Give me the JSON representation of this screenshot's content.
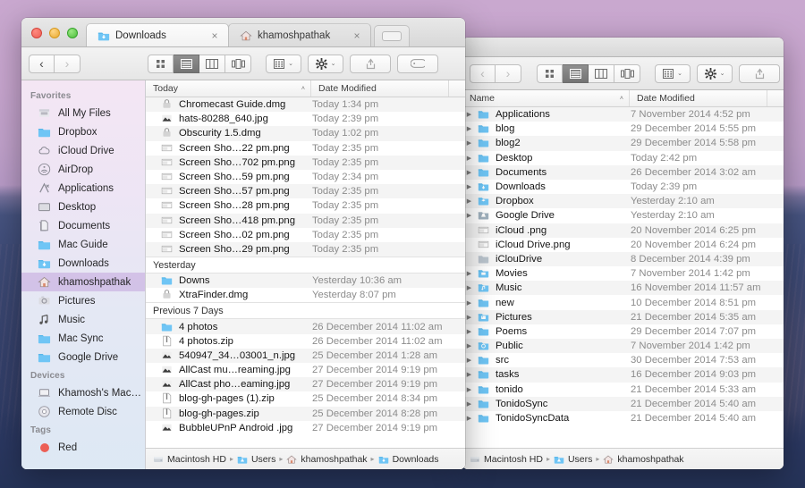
{
  "window_left": {
    "tabs": [
      {
        "label": "Downloads",
        "icon": "downloads-folder-icon",
        "active": true,
        "close": "×"
      },
      {
        "label": "khamoshpathak",
        "icon": "home-folder-icon",
        "active": false,
        "close": "×"
      }
    ],
    "new_tab_label": "+",
    "toolbar": {
      "back": "‹",
      "forward": "›",
      "view_icon": "icon-view-icon",
      "view_list": "list-view-icon",
      "view_column": "column-view-icon",
      "view_coverflow": "coverflow-view-icon",
      "arrange": "arrange-icon",
      "action": "gear-icon",
      "share": "share-icon",
      "tags": "tag-icon",
      "dropbox": "dropbox-icon",
      "overflow": "»",
      "caret": "⌄"
    },
    "columns": {
      "name": "Today",
      "date": "Date Modified",
      "sort": "˄"
    },
    "groups": [
      {
        "title": "Today",
        "is_header_column": true,
        "files": [
          {
            "name": "Chromecast Guide.dmg",
            "date": "Today 1:34 pm",
            "icon": "dmg-icon"
          },
          {
            "name": "hats-80288_640.jpg",
            "date": "Today 2:39 pm",
            "icon": "jpg-icon"
          },
          {
            "name": "Obscurity 1.5.dmg",
            "date": "Today 1:02 pm",
            "icon": "dmg-icon"
          },
          {
            "name": "Screen Sho…22 pm.png",
            "date": "Today 2:35 pm",
            "icon": "png-thumb-icon"
          },
          {
            "name": "Screen Sho…702 pm.png",
            "date": "Today 2:35 pm",
            "icon": "png-thumb-icon"
          },
          {
            "name": "Screen Sho…59 pm.png",
            "date": "Today 2:34 pm",
            "icon": "png-thumb-icon"
          },
          {
            "name": "Screen Sho…57 pm.png",
            "date": "Today 2:35 pm",
            "icon": "png-thumb-icon"
          },
          {
            "name": "Screen Sho…28 pm.png",
            "date": "Today 2:35 pm",
            "icon": "png-thumb-icon"
          },
          {
            "name": "Screen Sho…418 pm.png",
            "date": "Today 2:35 pm",
            "icon": "png-thumb-icon"
          },
          {
            "name": "Screen Sho…02 pm.png",
            "date": "Today 2:35 pm",
            "icon": "png-thumb-icon"
          },
          {
            "name": "Screen Sho…29 pm.png",
            "date": "Today 2:35 pm",
            "icon": "png-thumb-icon"
          }
        ]
      },
      {
        "title": "Yesterday",
        "files": [
          {
            "name": "Downs",
            "date": "Yesterday 10:36 am",
            "icon": "folder-icon"
          },
          {
            "name": "XtraFinder.dmg",
            "date": "Yesterday 8:07 pm",
            "icon": "dmg-icon"
          }
        ]
      },
      {
        "title": "Previous 7 Days",
        "files": [
          {
            "name": "4 photos",
            "date": "26 December 2014 11:02 am",
            "icon": "folder-icon"
          },
          {
            "name": "4 photos.zip",
            "date": "26 December 2014 11:02 am",
            "icon": "zip-icon"
          },
          {
            "name": "540947_34…03001_n.jpg",
            "date": "25 December 2014 1:28 am",
            "icon": "jpg-icon"
          },
          {
            "name": "AllCast mu…reaming.jpg",
            "date": "27 December 2014 9:19 pm",
            "icon": "jpg-icon"
          },
          {
            "name": "AllCast pho…eaming.jpg",
            "date": "27 December 2014 9:19 pm",
            "icon": "jpg-icon"
          },
          {
            "name": "blog-gh-pages (1).zip",
            "date": "25 December 2014 8:34 pm",
            "icon": "zip-icon"
          },
          {
            "name": "blog-gh-pages.zip",
            "date": "25 December 2014 8:28 pm",
            "icon": "zip-icon"
          },
          {
            "name": "BubbleUPnP Android .jpg",
            "date": "27 December 2014 9:19 pm",
            "icon": "jpg-icon"
          }
        ]
      }
    ],
    "pathbar": [
      {
        "label": "Macintosh HD",
        "icon": "harddisk-icon"
      },
      {
        "label": "Users",
        "icon": "users-folder-icon"
      },
      {
        "label": "khamoshpathak",
        "icon": "home-folder-icon"
      },
      {
        "label": "Downloads",
        "icon": "downloads-folder-icon"
      }
    ],
    "path_separator": "▸"
  },
  "sidebar": {
    "sections": [
      {
        "title": "Favorites",
        "items": [
          {
            "label": "All My Files",
            "icon": "all-my-files-icon",
            "selected": false
          },
          {
            "label": "Dropbox",
            "icon": "folder-icon",
            "selected": false
          },
          {
            "label": "iCloud Drive",
            "icon": "icloud-icon",
            "selected": false
          },
          {
            "label": "AirDrop",
            "icon": "airdrop-icon",
            "selected": false
          },
          {
            "label": "Applications",
            "icon": "applications-icon",
            "selected": false
          },
          {
            "label": "Desktop",
            "icon": "desktop-icon",
            "selected": false
          },
          {
            "label": "Documents",
            "icon": "documents-icon",
            "selected": false
          },
          {
            "label": "Mac Guide",
            "icon": "folder-icon",
            "selected": false
          },
          {
            "label": "Downloads",
            "icon": "downloads-icon",
            "selected": false
          },
          {
            "label": "khamoshpathak",
            "icon": "home-folder-icon",
            "selected": true
          },
          {
            "label": "Pictures",
            "icon": "pictures-icon",
            "selected": false
          },
          {
            "label": "Music",
            "icon": "music-icon",
            "selected": false
          },
          {
            "label": "Mac Sync",
            "icon": "folder-icon",
            "selected": false
          },
          {
            "label": "Google Drive",
            "icon": "folder-icon",
            "selected": false
          }
        ]
      },
      {
        "title": "Devices",
        "items": [
          {
            "label": "Khamosh's MacB…",
            "icon": "laptop-icon",
            "selected": false
          },
          {
            "label": "Remote Disc",
            "icon": "remote-disc-icon",
            "selected": false
          }
        ]
      },
      {
        "title": "Tags",
        "items": [
          {
            "label": "Red",
            "icon": "tag-dot-red",
            "color": "#ec5f55",
            "selected": false
          }
        ]
      }
    ]
  },
  "window_right": {
    "toolbar": {
      "back": "‹",
      "forward": "›",
      "overflow": "»",
      "caret": "⌄"
    },
    "columns": {
      "name": "Name",
      "date": "Date Modified",
      "sort": "˄"
    },
    "files": [
      {
        "name": "Applications",
        "date": "7 November 2014 4:52 pm",
        "icon": "folder-icon",
        "disclosure": true
      },
      {
        "name": "blog",
        "date": "29 December 2014 5:55 pm",
        "icon": "folder-icon",
        "disclosure": true
      },
      {
        "name": "blog2",
        "date": "29 December 2014 5:58 pm",
        "icon": "folder-icon",
        "disclosure": true
      },
      {
        "name": "Desktop",
        "date": "Today 2:42 pm",
        "icon": "folder-icon",
        "disclosure": true
      },
      {
        "name": "Documents",
        "date": "26 December 2014 3:02 am",
        "icon": "folder-icon",
        "disclosure": true
      },
      {
        "name": "Downloads",
        "date": "Today 2:39 pm",
        "icon": "downloads-folder-icon",
        "disclosure": true
      },
      {
        "name": "Dropbox",
        "date": "Yesterday 2:10 am",
        "icon": "dropbox-folder-icon",
        "disclosure": true
      },
      {
        "name": "Google Drive",
        "date": "Yesterday 2:10 am",
        "icon": "gdrive-folder-icon",
        "disclosure": true
      },
      {
        "name": "iCloud .png",
        "date": "20 November 2014 6:25 pm",
        "icon": "png-thumb-icon",
        "disclosure": false
      },
      {
        "name": "iCloud Drive.png",
        "date": "20 November 2014 6:24 pm",
        "icon": "png-thumb-icon",
        "disclosure": false
      },
      {
        "name": "iClouDrive",
        "date": "8 December 2014 4:39 pm",
        "icon": "gray-folder-icon",
        "disclosure": false
      },
      {
        "name": "Movies",
        "date": "7 November 2014 1:42 pm",
        "icon": "movies-folder-icon",
        "disclosure": true
      },
      {
        "name": "Music",
        "date": "16 November 2014 11:57 am",
        "icon": "music-folder-icon",
        "disclosure": true
      },
      {
        "name": "new",
        "date": "10 December 2014 8:51 pm",
        "icon": "folder-icon",
        "disclosure": true
      },
      {
        "name": "Pictures",
        "date": "21 December 2014 5:35 am",
        "icon": "pictures-folder-icon",
        "disclosure": true
      },
      {
        "name": "Poems",
        "date": "29 December 2014 7:07 pm",
        "icon": "folder-icon",
        "disclosure": true
      },
      {
        "name": "Public",
        "date": "7 November 2014 1:42 pm",
        "icon": "public-folder-icon",
        "disclosure": true
      },
      {
        "name": "src",
        "date": "30 December 2014 7:53 am",
        "icon": "folder-icon",
        "disclosure": true
      },
      {
        "name": "tasks",
        "date": "16 December 2014 9:03 pm",
        "icon": "folder-icon",
        "disclosure": true
      },
      {
        "name": "tonido",
        "date": "21 December 2014 5:33 am",
        "icon": "folder-icon",
        "disclosure": true
      },
      {
        "name": "TonidoSync",
        "date": "21 December 2014 5:40 am",
        "icon": "folder-icon",
        "disclosure": true
      },
      {
        "name": "TonidoSyncData",
        "date": "21 December 2014 5:40 am",
        "icon": "folder-icon",
        "disclosure": true
      }
    ],
    "pathbar": [
      {
        "label": "Macintosh HD",
        "icon": "harddisk-icon"
      },
      {
        "label": "Users",
        "icon": "users-folder-icon"
      },
      {
        "label": "khamoshpathak",
        "icon": "home-folder-icon"
      }
    ],
    "path_separator": "▸"
  },
  "colors": {
    "sidebar_selection": "#ba94d6",
    "folder_blue": "#6fc5f5",
    "traffic_red": "#ec5f55",
    "traffic_yellow": "#e8a92f",
    "traffic_green": "#4cbd3c",
    "tag_red": "#ec5f55",
    "active_view_button": "#7c7c7c"
  }
}
